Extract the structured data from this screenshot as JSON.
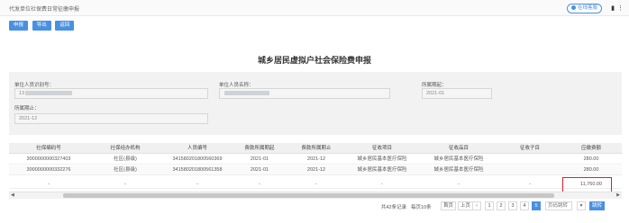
{
  "header": {
    "title": "代发单位社保费日常征缴申报",
    "online_label": "在线客服"
  },
  "toolbar": {
    "buttons": [
      "申报",
      "导出",
      "返回"
    ]
  },
  "page_title": "城乡居民虚拟户社会保险费申报",
  "form": {
    "fields": [
      {
        "label": "单位人员识别号：",
        "value": "13"
      },
      {
        "label": "单位人员名称：",
        "value": ""
      },
      {
        "label": "所属期起：",
        "value": "2021-01"
      },
      {
        "label": "所属期止：",
        "value": "2021-12"
      }
    ]
  },
  "table": {
    "columns": [
      "社保编码号",
      "社保经办机构",
      "人员编号",
      "费款所属期起",
      "费款所属期止",
      "征收项目",
      "征收品目",
      "征收子目",
      "应缴费额"
    ],
    "rows": [
      [
        "3000000000327403",
        "社区(县级)",
        "341580201800560369",
        "2021-01",
        "2021-12",
        "城乡居民基本医疗保险",
        "城乡居民基本医疗保险",
        "",
        "280.00"
      ],
      [
        "3000000000332276",
        "社区(县级)",
        "341580201800561358",
        "2021-01",
        "2021-12",
        "城乡居民基本医疗保险",
        "城乡居民基本医疗保险",
        "",
        "280.00"
      ],
      [
        "-",
        "-",
        "-",
        "-",
        "-",
        "-",
        "-",
        "-",
        "11,760.00"
      ]
    ]
  },
  "pagination": {
    "total_text": "共42条记录",
    "page_size_text": "每页10条",
    "first": "首页",
    "prev": "上页",
    "pages": [
      "1",
      "2",
      "3",
      "4",
      "5"
    ],
    "active_page": "5",
    "goto_placeholder": "页码跳转",
    "go": "跳转"
  }
}
